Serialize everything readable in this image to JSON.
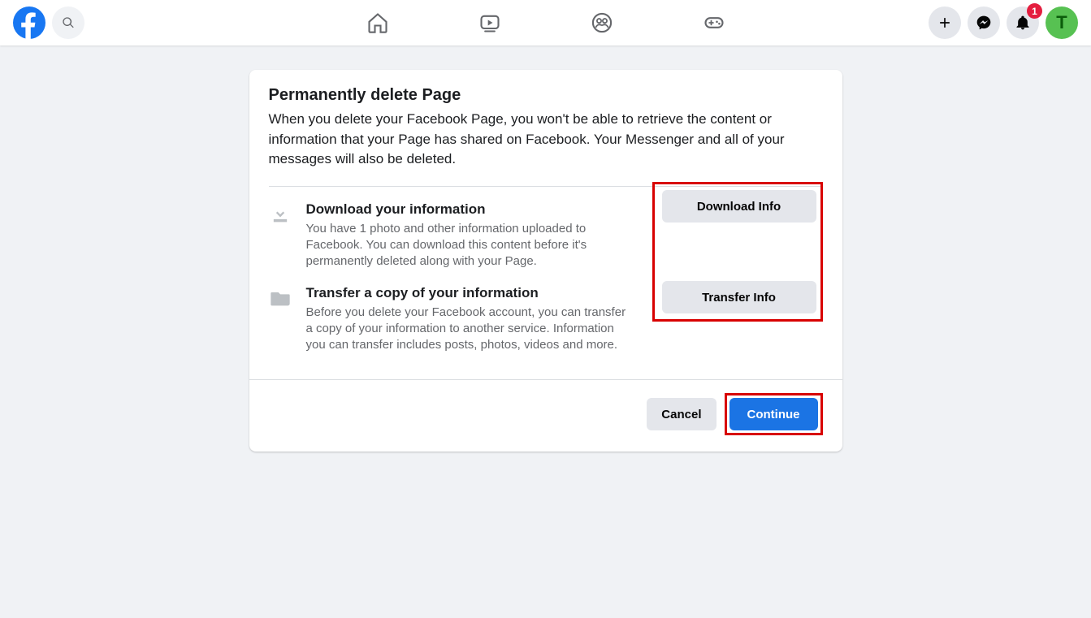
{
  "nav": {
    "notification_badge": "1",
    "avatar_initial": "T"
  },
  "dialog": {
    "title": "Permanently delete Page",
    "description": "When you delete your Facebook Page, you won't be able to retrieve the content or information that your Page has shared on Facebook. Your Messenger and all of your messages will also be deleted.",
    "download": {
      "title": "Download your information",
      "body": "You have 1 photo and other information uploaded to Facebook. You can download this content before it's permanently deleted along with your Page.",
      "button": "Download Info"
    },
    "transfer": {
      "title": "Transfer a copy of your information",
      "body": "Before you delete your Facebook account, you can transfer a copy of your information to another service. Information you can transfer includes posts, photos, videos and more.",
      "button": "Transfer Info"
    },
    "cancel_label": "Cancel",
    "continue_label": "Continue"
  }
}
